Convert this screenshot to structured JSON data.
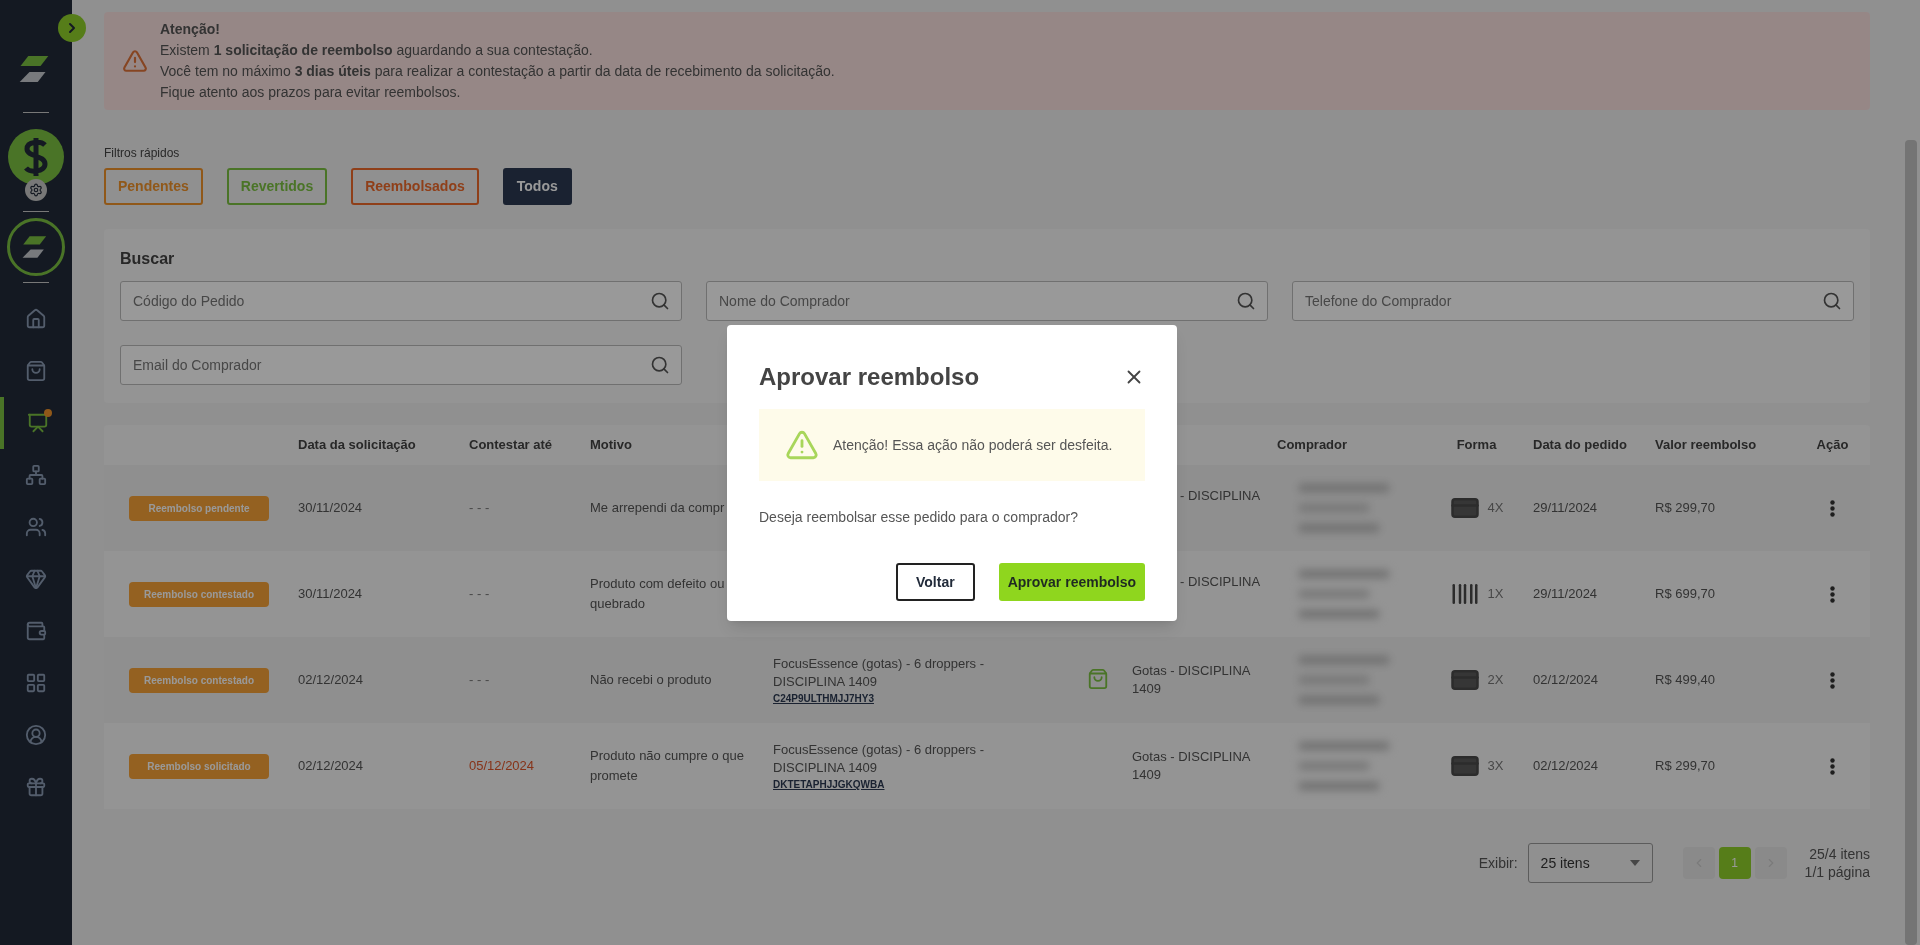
{
  "alert": {
    "title": "Atenção!",
    "lines": [
      "Existem **1 solicitação de reembolso** aguardando a sua contestação.",
      "Você tem no máximo **3 dias úteis** para realizar a contestação a partir da data de recebimento da solicitação.",
      "Fique atento aos prazos para evitar reembolsos."
    ]
  },
  "sidebar": {
    "items": [
      {
        "selected": false
      },
      {
        "selected": false
      },
      {
        "selected": true
      },
      {
        "selected": false
      },
      {
        "selected": false
      },
      {
        "selected": false
      },
      {
        "selected": false
      },
      {
        "selected": false
      },
      {
        "selected": false
      },
      {
        "selected": false
      }
    ]
  },
  "quick_filters": {
    "label": "Filtros rápidos",
    "items": [
      {
        "label": "Pendentes",
        "kind": "pending",
        "selected": false
      },
      {
        "label": "Revertidos",
        "kind": "reverted",
        "selected": false
      },
      {
        "label": "Reembolsados",
        "kind": "refunded",
        "selected": false
      },
      {
        "label": "Todos",
        "kind": "all",
        "selected": true
      }
    ]
  },
  "search": {
    "title": "Buscar",
    "fields": [
      {
        "placeholder": "Código do Pedido"
      },
      {
        "placeholder": "Nome do Comprador"
      },
      {
        "placeholder": "Telefone do Comprador"
      },
      {
        "placeholder": "Email do Comprador"
      }
    ]
  },
  "table": {
    "columns": [
      "",
      "Data da solicitação",
      "Contestar até",
      "Motivo",
      "",
      "",
      "",
      "Comprador",
      "Forma",
      "Data do pedido",
      "Valor reembolso",
      "Ação"
    ],
    "rows": [
      {
        "status": "Reembolso pendente",
        "request_date": "30/11/2024",
        "contest_until": "- - -",
        "urgent": false,
        "reason": "Me arrependi da compr",
        "product": null,
        "code": null,
        "bag": false,
        "plan": "- DISCIPLINA",
        "plan_clipped": true,
        "kind": "card",
        "installments": "4X",
        "order_date": "29/11/2024",
        "value": "R$ 299,70"
      },
      {
        "status": "Reembolso contestado",
        "request_date": "30/11/2024",
        "contest_until": "- - -",
        "urgent": false,
        "reason": "Produto com defeito ou quebrado",
        "product": null,
        "code": null,
        "bag": false,
        "plan": "- DISCIPLINA",
        "plan_clipped": true,
        "kind": "boleto",
        "installments": "1X",
        "order_date": "29/11/2024",
        "value": "R$ 699,70"
      },
      {
        "status": "Reembolso contestado",
        "request_date": "02/12/2024",
        "contest_until": "- - -",
        "urgent": false,
        "reason": "Não recebi o produto",
        "product": "FocusEssence (gotas) - 6 droppers - DISCIPLINA 1409",
        "code": "C24P9ULTHMJJ7HY3",
        "bag": true,
        "plan": "Gotas - DISCIPLINA 1409",
        "plan_clipped": false,
        "kind": "card",
        "installments": "2X",
        "order_date": "02/12/2024",
        "value": "R$ 499,40"
      },
      {
        "status": "Reembolso solicitado",
        "request_date": "02/12/2024",
        "contest_until": "05/12/2024",
        "urgent": true,
        "reason": "Produto não cumpre o que promete",
        "product": "FocusEssence (gotas) - 6 droppers - DISCIPLINA 1409",
        "code": "DKTETAPHJJGKQWBA",
        "bag": false,
        "plan": "Gotas - DISCIPLINA 1409",
        "plan_clipped": false,
        "kind": "card",
        "installments": "3X",
        "order_date": "02/12/2024",
        "value": "R$ 299,70"
      }
    ]
  },
  "pagination": {
    "show_label": "Exibir:",
    "page_size": "25 itens",
    "pages": [
      {
        "label": "1",
        "selected": true
      }
    ],
    "items_summary": "25/4 itens",
    "pages_summary": "1/1 página"
  },
  "modal": {
    "title": "Aprovar reembolso",
    "warning": "Atenção! Essa ação não poderá ser desfeita.",
    "question": "Deseja reembolsar esse pedido para o comprador?",
    "buttons": [
      {
        "label": "Voltar",
        "kind": "secondary"
      },
      {
        "label": "Aprovar reembolso",
        "kind": "primary"
      }
    ]
  }
}
